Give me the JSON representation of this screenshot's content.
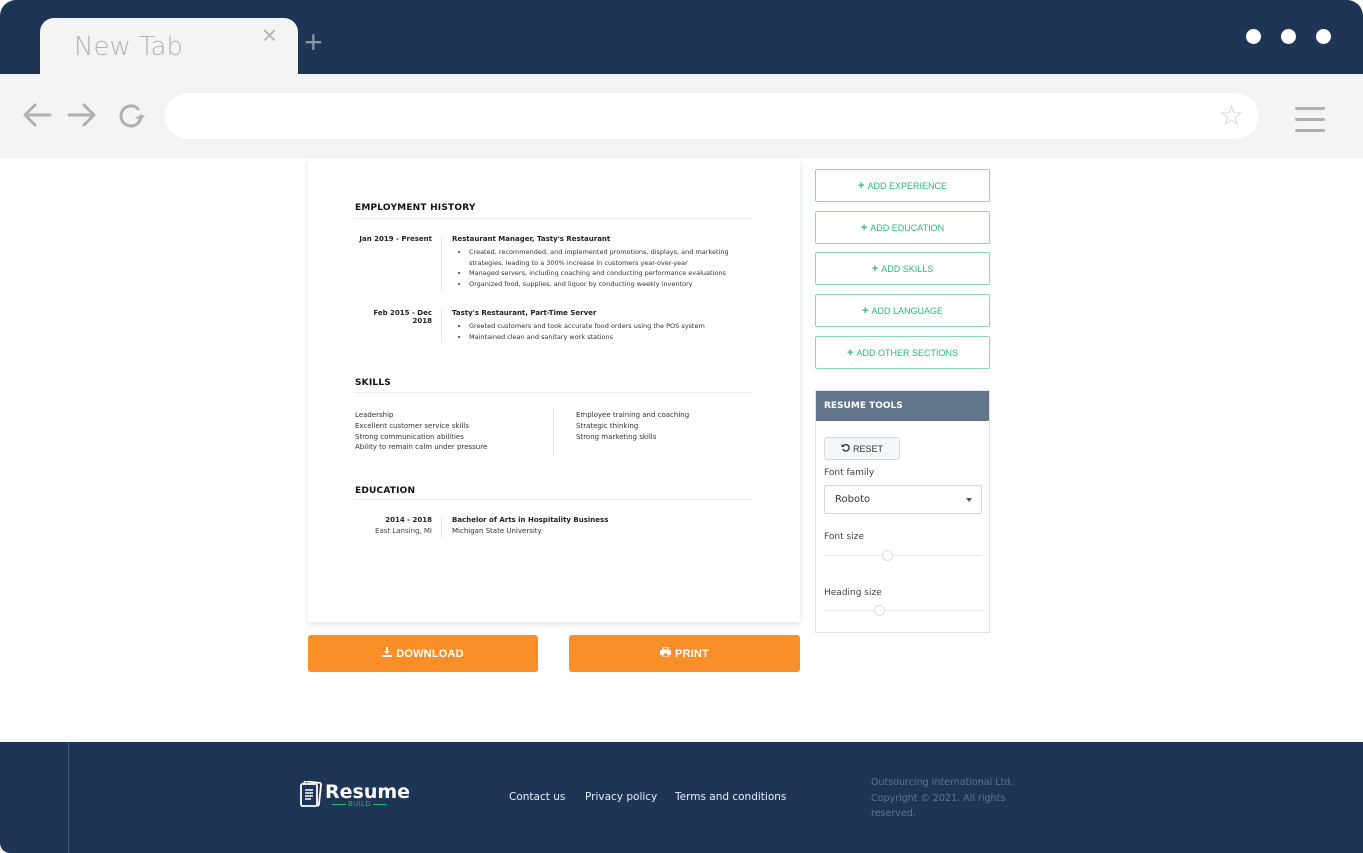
{
  "browser": {
    "tab_title": "New Tab",
    "tab_close": "×",
    "new_tab": "+",
    "url": ""
  },
  "resume": {
    "employment": {
      "title": "EMPLOYMENT HISTORY",
      "entries": [
        {
          "date": "Jan 2019 - Present",
          "title": "Restaurant Manager, Tasty's Restaurant",
          "bullets": [
            "Created, recommended, and implemented promotions, displays, and marketing strategies, leading to a 300% increase in customers year-over-year",
            "Managed servers, including coaching and conducting performance evaluations",
            "Organized food, supplies, and liquor by conducting weekly inventory"
          ]
        },
        {
          "date": "Feb 2015 - Dec 2018",
          "title": "Tasty's Restaurant, Part-Time Server",
          "bullets": [
            "Greeted customers and took accurate food orders using the POS system",
            "Maintained clean and sanitary work stations"
          ]
        }
      ]
    },
    "skills": {
      "title": "SKILLS",
      "left": [
        "Leadership",
        "Excellent customer service skills",
        "Strong communication abilities",
        "Ability to remain calm under pressure"
      ],
      "right": [
        "Employee training and coaching",
        "Strategic thinking",
        "Strong marketing skills"
      ]
    },
    "education": {
      "title": "EDUCATION",
      "entries": [
        {
          "date": "2014 - 2018",
          "location": "East Lansing, MI",
          "degree": "Bachelor of Arts in Hospitality Business",
          "school": "Michigan State University"
        }
      ]
    }
  },
  "actions": {
    "download": "DOWNLOAD",
    "print": "PRINT"
  },
  "sidebar": {
    "add_buttons": [
      "ADD EXPERIENCE",
      "ADD EDUCATION",
      "ADD SKILLS",
      "ADD LANGUAGE",
      "ADD OTHER SECTIONS"
    ],
    "tools": {
      "title": "RESUME TOOLS",
      "reset": "RESET",
      "font_family_label": "Font family",
      "font_family_value": "Roboto",
      "font_size_label": "Font size",
      "font_size_fraction": 0.4,
      "heading_size_label": "Heading size",
      "heading_size_fraction": 0.35
    }
  },
  "footer": {
    "logo_text": "Resume",
    "logo_sub": "BUILD",
    "links": [
      "Contact us",
      "Privacy policy",
      "Terms and conditions"
    ],
    "copyright": "Outsourcing International Ltd. Copyright © 2021. All rights reserved."
  },
  "colors": {
    "chrome": "#1f3556",
    "accent_green": "#30b676",
    "accent_orange": "#fa8f2a",
    "tools_header": "#62758b"
  }
}
